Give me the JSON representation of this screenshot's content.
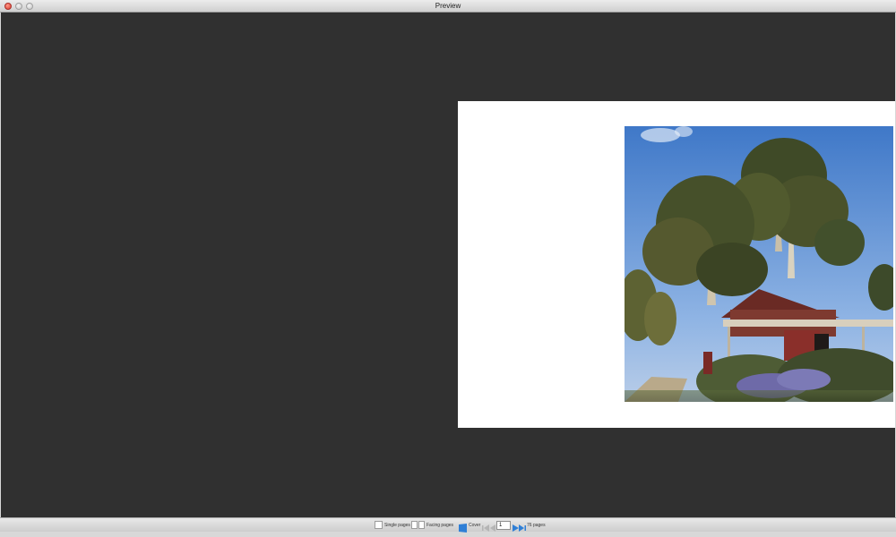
{
  "window": {
    "title": "Preview"
  },
  "colors": {
    "viewer_background": "#303030",
    "accent": "#2f7fd6"
  },
  "bottombar": {
    "single_pages_label": "Single pages",
    "facing_pages_label": "Facing pages",
    "cover_label": "Cover",
    "page_number": "1",
    "page_count_label": "76 pages"
  },
  "icons": [
    "close-icon",
    "minimize-icon",
    "zoom-icon",
    "single-page-icon",
    "facing-pages-icon",
    "cover-icon",
    "first-page-icon",
    "previous-page-icon",
    "next-page-icon",
    "last-page-icon"
  ]
}
